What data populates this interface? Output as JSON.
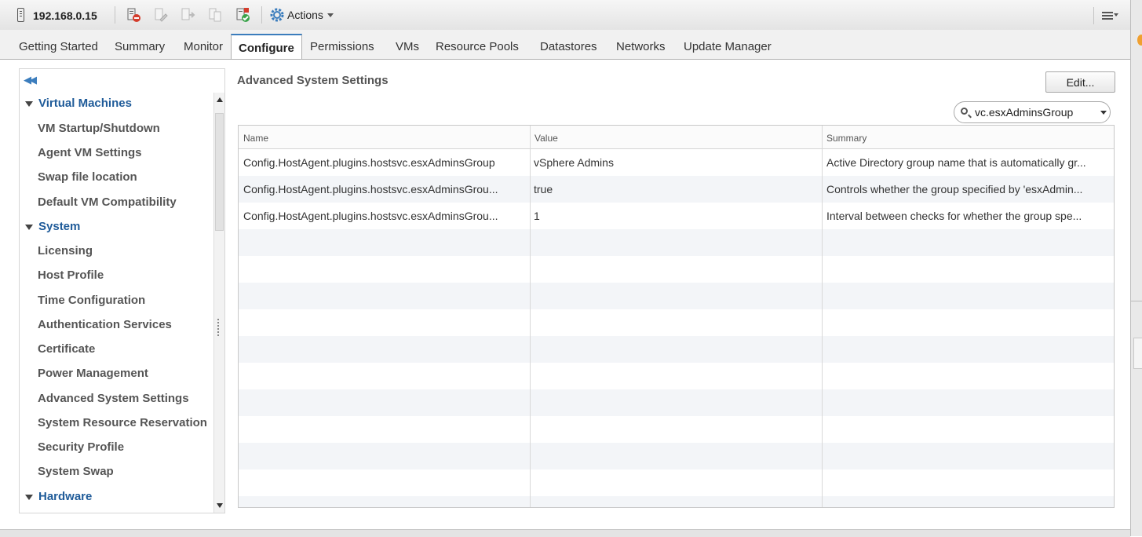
{
  "toolbar": {
    "host": "192.168.0.15",
    "actions_label": "Actions",
    "icons": [
      "host-icon",
      "add-host-icon",
      "edit-icon",
      "exit-maintenance-icon",
      "clone-icon",
      "remove-icon",
      "gear-icon",
      "menu-icon"
    ]
  },
  "tabs": [
    {
      "label": "Getting Started"
    },
    {
      "label": "Summary"
    },
    {
      "label": "Monitor"
    },
    {
      "label": "Configure",
      "active": true
    },
    {
      "label": "Permissions"
    },
    {
      "label": "VMs"
    },
    {
      "label": "Resource Pools"
    },
    {
      "label": "Datastores"
    },
    {
      "label": "Networks"
    },
    {
      "label": "Update Manager"
    }
  ],
  "nav": {
    "groups": [
      {
        "label": "Virtual Machines",
        "items": [
          "VM Startup/Shutdown",
          "Agent VM Settings",
          "Swap file location",
          "Default VM Compatibility"
        ]
      },
      {
        "label": "System",
        "items": [
          "Licensing",
          "Host Profile",
          "Time Configuration",
          "Authentication Services",
          "Certificate",
          "Power Management",
          "Advanced System Settings",
          "System Resource Reservation",
          "Security Profile",
          "System Swap"
        ]
      },
      {
        "label": "Hardware",
        "items": []
      }
    ]
  },
  "content": {
    "title": "Advanced System Settings",
    "edit_label": "Edit...",
    "filter_value": "vc.esxAdminsGroup",
    "columns": [
      "Name",
      "Value",
      "Summary"
    ],
    "rows": [
      {
        "name": "Config.HostAgent.plugins.hostsvc.esxAdminsGroup",
        "value": "vSphere Admins",
        "summary": "Active Directory group name that is automatically gr..."
      },
      {
        "name": "Config.HostAgent.plugins.hostsvc.esxAdminsGrou...",
        "value": "true",
        "summary": "Controls whether the group specified by 'esxAdmin..."
      },
      {
        "name": "Config.HostAgent.plugins.hostsvc.esxAdminsGrou...",
        "value": "1",
        "summary": "Interval between checks for whether the group spe..."
      }
    ]
  },
  "colors": {
    "accent": "#3b7dbd",
    "group_text": "#1f5b99",
    "row_alt": "#f3f5f8"
  }
}
